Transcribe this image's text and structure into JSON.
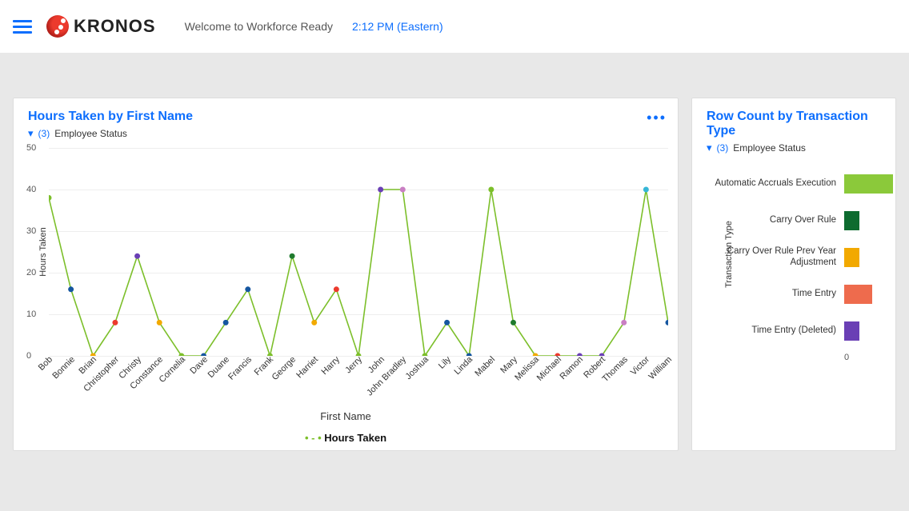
{
  "header": {
    "brand": "KRONOS",
    "welcome": "Welcome to Workforce Ready",
    "time": "2:12 PM (Eastern)"
  },
  "panel_left": {
    "title": "Hours Taken by First Name",
    "filter_count": "(3)",
    "filter_label": "Employee Status",
    "more_label": "•••",
    "ylabel": "Hours Taken",
    "xlabel": "First Name",
    "legend": "Hours Taken"
  },
  "panel_right": {
    "title": "Row Count by Transaction Type",
    "filter_count": "(3)",
    "filter_label": "Employee Status",
    "ylabel": "Transaction Type",
    "scale_zero": "0"
  },
  "chart_data": [
    {
      "type": "line",
      "title": "Hours Taken by First Name",
      "xlabel": "First Name",
      "ylabel": "Hours Taken",
      "ylim": [
        0,
        50
      ],
      "yticks": [
        0,
        10,
        20,
        30,
        40,
        50
      ],
      "categories": [
        "Bob",
        "Bonnie",
        "Brian",
        "Christopher",
        "Christy",
        "Constance",
        "Cornelia",
        "Dave",
        "Duane",
        "Francis",
        "Frank",
        "George",
        "Harriet",
        "Harry",
        "Jerry",
        "John",
        "John Bradley",
        "Joshua",
        "Lily",
        "Linda",
        "Mabel",
        "Mary",
        "Melissa",
        "Michael",
        "Ramon",
        "Robert",
        "Thomas",
        "Victor",
        "William"
      ],
      "series": [
        {
          "name": "Hours Taken",
          "values": [
            38,
            16,
            0,
            8,
            24,
            8,
            0,
            0,
            8,
            16,
            0,
            24,
            8,
            16,
            0,
            40,
            40,
            0,
            8,
            0,
            40,
            8,
            0,
            0,
            0,
            0,
            8,
            40,
            8
          ],
          "point_colors": [
            "#7cbf2a",
            "#1556a0",
            "#f2a900",
            "#ec3a2d",
            "#6a3fb5",
            "#f2a900",
            "#7cbf2a",
            "#1556a0",
            "#1556a0",
            "#1556a0",
            "#7cbf2a",
            "#1f7a2e",
            "#f2a900",
            "#ec3a2d",
            "#7cbf2a",
            "#6a3fb5",
            "#c97fc3",
            "#7cbf2a",
            "#1556a0",
            "#1556a0",
            "#7cbf2a",
            "#1f7a2e",
            "#f2a900",
            "#ec3a2d",
            "#6a3fb5",
            "#6a3fb5",
            "#c97fc3",
            "#35b6d6",
            "#1556a0"
          ]
        }
      ],
      "line_color": "#7cbf2a"
    },
    {
      "type": "bar",
      "orientation": "horizontal",
      "title": "Row Count by Transaction Type",
      "ylabel": "Transaction Type",
      "categories": [
        "Automatic Accruals Execution",
        "Carry Over Rule",
        "Carry Over Rule Prev Year Adjustment",
        "Time Entry",
        "Time Entry (Deleted)"
      ],
      "values": [
        95,
        30,
        30,
        55,
        30
      ],
      "colors": [
        "#8bc93a",
        "#0d6b2f",
        "#f2a900",
        "#ee6b4d",
        "#6a3fb5"
      ],
      "xlim": [
        0,
        100
      ]
    }
  ]
}
